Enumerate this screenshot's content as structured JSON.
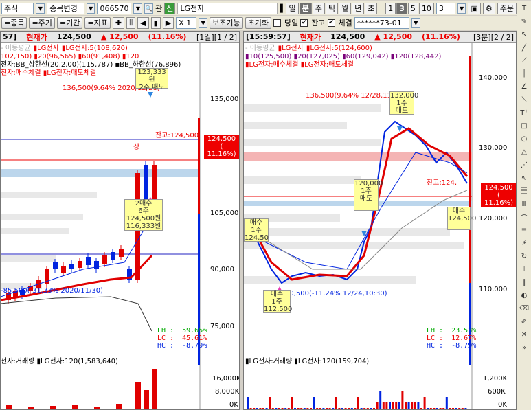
{
  "toolbar1": {
    "market": "주식",
    "change_label": "종목변경",
    "code": "066570",
    "prefix": "관",
    "badge": "신",
    "name": "LG전자",
    "periods": [
      "일",
      "분",
      "주",
      "틱",
      "월",
      "년",
      "초"
    ],
    "active_period": "분",
    "intervals": [
      "1",
      "3",
      "5",
      "10"
    ],
    "active_interval": "3",
    "interval_value": "3",
    "order_label": "주문"
  },
  "toolbar2": {
    "buttons": [
      "=종목",
      "=주기",
      "=기간",
      "=지표"
    ],
    "multiplier": "X 1",
    "assist_label": "보조기능",
    "reset_label": "초기화",
    "today_label": "당일",
    "balance_label": "잔고",
    "fill_label": "체결",
    "account": "******73-01"
  },
  "left_panel": {
    "header_time": "57]",
    "header_label": "현재가",
    "price": "124,500",
    "change": "▲ 12,500",
    "rate": "(11.16%)",
    "period": "[1일][1 / 2]",
    "legend": [
      {
        "text": "- 이동평균",
        "color": "#aaa"
      },
      {
        "text": "▮LG전자",
        "color": "#e00"
      },
      {
        "text": "▮LG전자:5(108,620)",
        "color": "#e00"
      }
    ],
    "legend2": "102,150) ▮20(96,565) ▮60(91,408) ▮120",
    "legend3": "전자:BB_상한선(20,2.00)(115,787) ▪BB_하한선(76,896)",
    "legend4": "전자:매수체결 ▮LG전자:매도체결",
    "high_note": "136,500(9.64% 2020/12/28)",
    "low_note": "-85,500(-31.33% 2020/11/30)",
    "balance_note": "잔고:124,500",
    "y_axis": [
      "135,000",
      "120,000",
      "105,000",
      "90,000",
      "75,000"
    ],
    "price_box": [
      "124,500",
      "( 11.16%)"
    ],
    "stats": [
      "LH :  59.65%",
      "LC :  45.61%",
      "HC :  -8.79%"
    ],
    "notes": [
      "123,333원",
      "2주",
      "매도",
      "2매수",
      "6주",
      "124,500원",
      "116,333원",
      "상"
    ],
    "volume_legend": "전자:거래량 ▮LG전자:120(1,583,640)",
    "volume_axis": [
      "16,000K",
      "8,000K",
      "0K"
    ]
  },
  "right_panel": {
    "header_time": "[15:59:57]",
    "header_label": "현재가",
    "price": "124,500",
    "change": "▲ 12,500",
    "rate": "(11.16%)",
    "period": "[3분][2 / 2]",
    "legend": [
      {
        "text": "- 이동평균",
        "color": "#aaa"
      },
      {
        "text": "▮LG전자",
        "color": "#e00"
      },
      {
        "text": "▮LG전자:5(124,600)",
        "color": "#e00"
      }
    ],
    "legend2": "▮10(125,500) ▮20(127,025) ▮60(129,042) ▮120(128,442)",
    "legend3": "▮LG전자:매수체결 ▮LG전자:매도체결",
    "high_note": "136,500(9.64% 12/28,11:",
    "high_box": "132,000",
    "low_note": "10,500(-11.24% 12/24,10:30)",
    "balance_note": "잔고:124,",
    "y_axis": [
      "140,000",
      "130,000",
      "120,000",
      "110,000"
    ],
    "price_box": [
      "124,500",
      "( 11.16%)"
    ],
    "stats": [
      "LH :  23.53%",
      "LC :  12.67%",
      "HC :  -8.79%"
    ],
    "notes": [
      "1주",
      "매도",
      "120,000",
      "1주",
      "매도",
      "매수",
      "1주",
      "124,50",
      "매수",
      "1주",
      "112,500",
      "매수",
      "124,500"
    ],
    "volume_legend": "▮LG전자:거래량 ▮LG전자:120(159,704)",
    "volume_axis": [
      "1,200K",
      "600K",
      "0K"
    ]
  },
  "colors": {
    "up": "#e00000",
    "down": "#0024e0",
    "ma5": "#e00000",
    "ma60": "#0024e0",
    "ma120": "#888888"
  }
}
